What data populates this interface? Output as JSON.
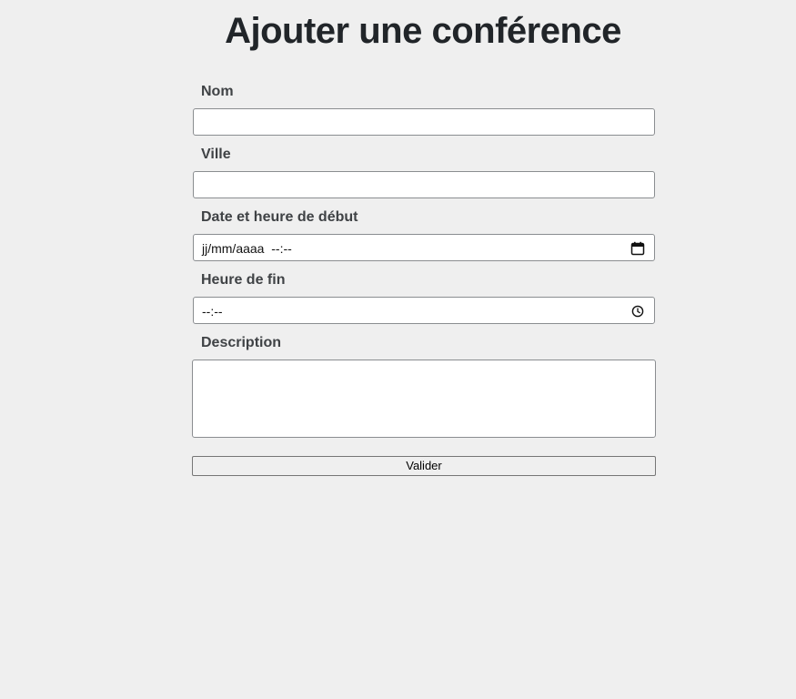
{
  "page": {
    "title": "Ajouter une conférence"
  },
  "form": {
    "name": {
      "label": "Nom",
      "value": ""
    },
    "city": {
      "label": "Ville",
      "value": ""
    },
    "start": {
      "label": "Date et heure de début",
      "placeholder": "jj/mm/aaaa  --:--",
      "icon": "calendar-icon"
    },
    "end": {
      "label": "Heure de fin",
      "placeholder": "--:--",
      "icon": "clock-icon"
    },
    "description": {
      "label": "Description",
      "value": ""
    },
    "submit_label": "Valider"
  }
}
